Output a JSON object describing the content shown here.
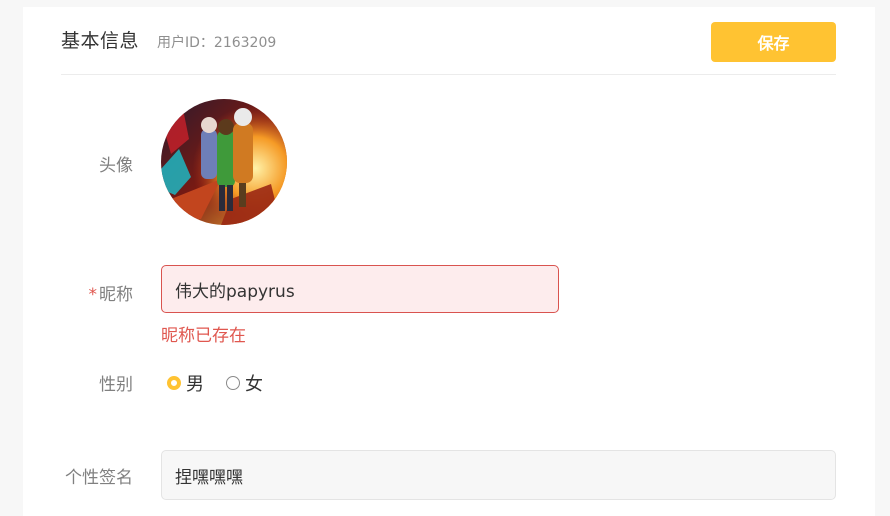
{
  "header": {
    "title": "基本信息",
    "user_id": "用户ID：2163209",
    "save_label": "保存"
  },
  "colors": {
    "accent": "#ffc332",
    "error": "#e0574f",
    "error_bg": "#fdeced"
  },
  "form": {
    "avatar": {
      "label": "头像",
      "icon": "avatar-image"
    },
    "nickname": {
      "required_mark": "*",
      "label": "昵称",
      "value": "伟大的papyrus",
      "error": "昵称已存在"
    },
    "gender": {
      "label": "性别",
      "options": [
        {
          "label": "男",
          "selected": true
        },
        {
          "label": "女",
          "selected": false
        }
      ]
    },
    "signature": {
      "label": "个性签名",
      "value": "捏嘿嘿嘿"
    }
  }
}
